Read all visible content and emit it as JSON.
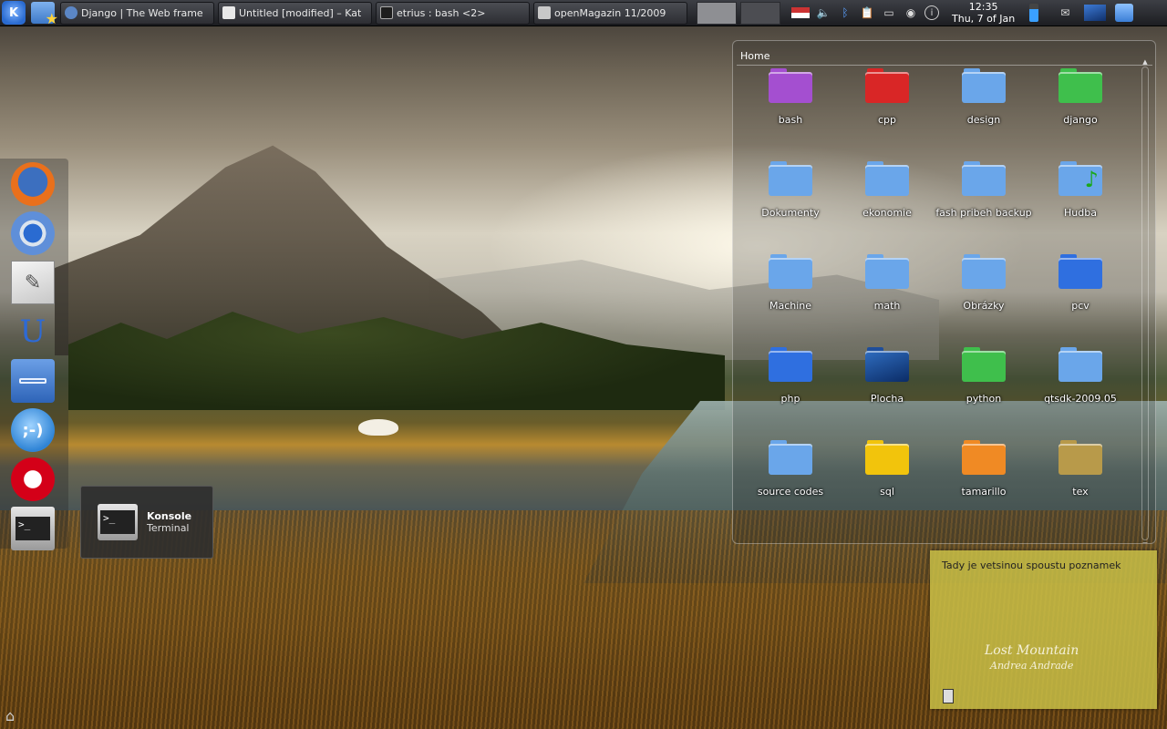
{
  "panel": {
    "tasks": [
      {
        "label": "Django | The Web frame",
        "color": "#5b86c5"
      },
      {
        "label": "Untitled [modified] – Kat",
        "color": "#e8e8e8"
      },
      {
        "label": "etrius : bash <2>",
        "color": "#1e1e1e"
      },
      {
        "label": "openMagazin 11/2009",
        "color": "#c8c8c8"
      }
    ],
    "clock_time": "12:35",
    "clock_date": "Thu, 7 of Jan"
  },
  "dock": {
    "items": [
      "firefox-icon",
      "chromium-icon",
      "kate-icon",
      "openoffice-icon",
      "file-manager-icon",
      "kopete-icon",
      "opera-icon",
      "konsole-icon"
    ]
  },
  "tooltip": {
    "title": "Konsole",
    "subtitle": "Terminal"
  },
  "folderview": {
    "title": "Home",
    "items": [
      {
        "label": "bash",
        "color": "#a44fd0"
      },
      {
        "label": "cpp",
        "color": "#d92626"
      },
      {
        "label": "design",
        "color": "#6aa6ea"
      },
      {
        "label": "django",
        "color": "#3fbf4c"
      },
      {
        "label": "Dokumenty",
        "color": "#6aa6ea"
      },
      {
        "label": "ekonomie",
        "color": "#6aa6ea"
      },
      {
        "label": "fash pribeh backup",
        "color": "#6aa6ea"
      },
      {
        "label": "Hudba",
        "color": "#6aa6ea"
      },
      {
        "label": "Machine",
        "color": "#6aa6ea"
      },
      {
        "label": "math",
        "color": "#6aa6ea"
      },
      {
        "label": "Obrázky",
        "color": "#6aa6ea"
      },
      {
        "label": "pcv",
        "color": "#2f6fe0"
      },
      {
        "label": "php",
        "color": "#2f6fe0"
      },
      {
        "label": "Plocha",
        "color": "#1f4e9a"
      },
      {
        "label": "python",
        "color": "#3fbf4c"
      },
      {
        "label": "qtsdk-2009.05",
        "color": "#6aa6ea"
      },
      {
        "label": "source codes",
        "color": "#6aa6ea"
      },
      {
        "label": "sql",
        "color": "#f2c40c"
      },
      {
        "label": "tamarillo",
        "color": "#f08a24"
      },
      {
        "label": "tex",
        "color": "#b89a4a"
      }
    ]
  },
  "note": {
    "text": "Tady je vetsinou spoustu poznamek",
    "caption1": "Lost Mountain",
    "caption2": "Andrea Andrade"
  }
}
